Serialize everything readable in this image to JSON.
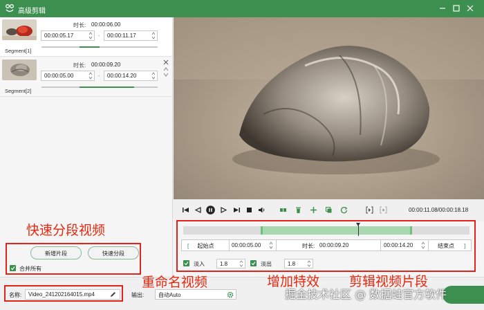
{
  "window": {
    "title": "高级剪辑"
  },
  "segments": [
    {
      "label": "Segment[1]",
      "duration_label": "时长:",
      "duration": "00:00:06.00",
      "start": "00:00:05.17",
      "end": "00:00:11.17",
      "separator": "-",
      "range_fraction": [
        0.33,
        0.5
      ]
    },
    {
      "label": "Segment[2]",
      "duration_label": "时长:",
      "duration": "00:00:09.20",
      "start": "00:00:05.00",
      "end": "00:00:14.20",
      "separator": "-",
      "range_fraction": [
        0.33,
        0.8
      ]
    }
  ],
  "left_actions": {
    "add_segment": "新增片段",
    "quick_split": "快速分段",
    "merge_all": "合并所有",
    "merge_checked": true
  },
  "player": {
    "time_readout": "00:00:11.08/00:00:18.18"
  },
  "edit": {
    "start_button": "起始点",
    "start_time": "00:00:05.00",
    "duration_label": "时长:",
    "duration": "00:00:09.20",
    "end_time": "00:00:14.20",
    "end_button": "结束点",
    "fade_in_label": "淡入",
    "fade_in_value": "1.8",
    "fade_in_checked": true,
    "fade_out_label": "淡出",
    "fade_out_value": "1.8",
    "fade_out_checked": true,
    "selection_fraction": [
      0.27,
      0.8
    ],
    "playhead_fraction": 0.61
  },
  "bottom": {
    "name_label": "名称:",
    "file_name": "Video_241202164015.mp4",
    "output_label": "输出:",
    "output_value": "自动Auto"
  },
  "annotations": {
    "quick_split": "快速分段视频",
    "rename": "重命名视频",
    "effects": "增加特效",
    "clip": "剪辑视频片段"
  },
  "watermark": "掘金技术社区 @ 数据蛙官方软件",
  "colors": {
    "accent": "#3d8f4f",
    "annotation": "#e2231a"
  }
}
